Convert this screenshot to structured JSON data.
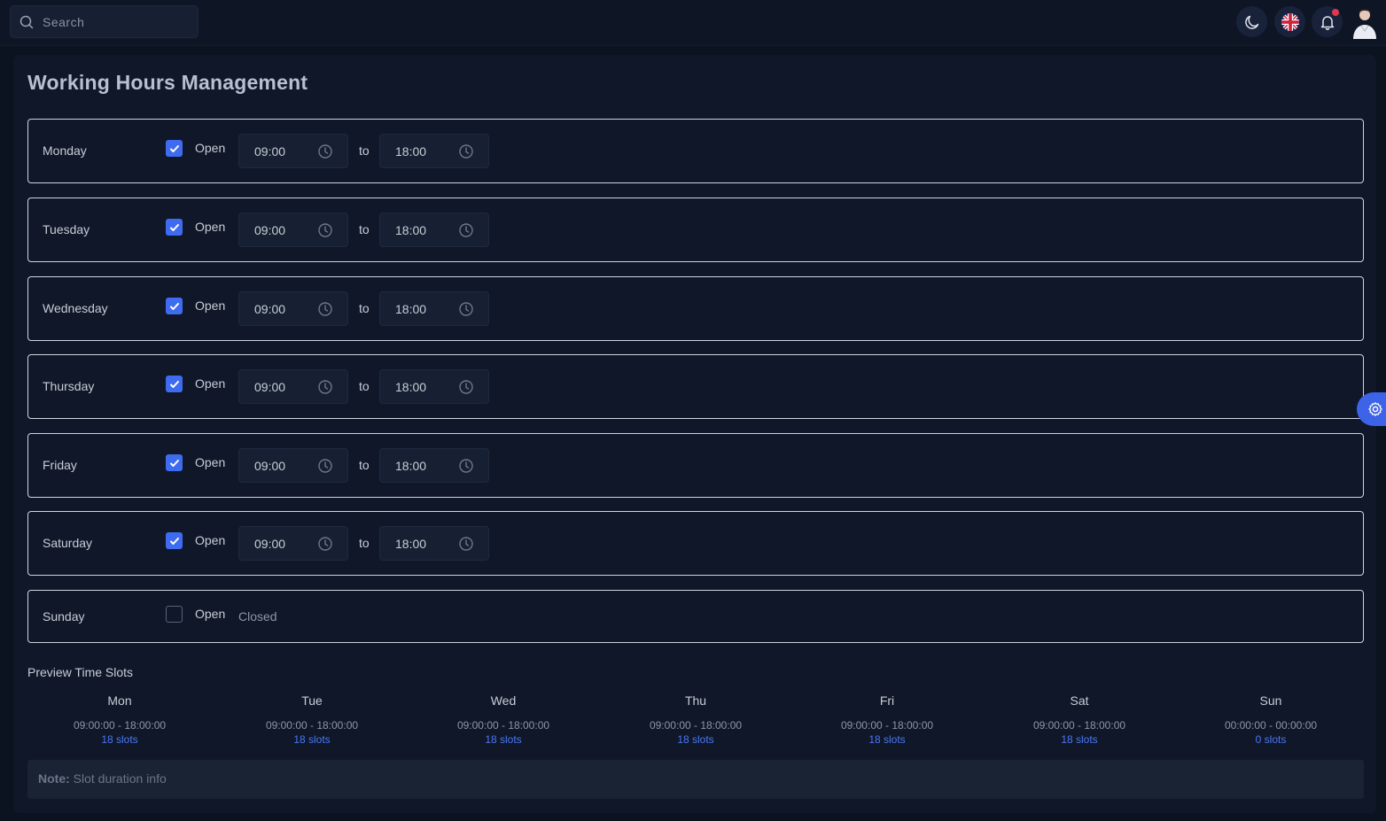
{
  "search": {
    "placeholder": "Search"
  },
  "page_title": "Working Hours Management",
  "open_label": "Open",
  "to_label": "to",
  "days": [
    {
      "name": "Monday",
      "open": true,
      "start": "09:00",
      "end": "18:00"
    },
    {
      "name": "Tuesday",
      "open": true,
      "start": "09:00",
      "end": "18:00"
    },
    {
      "name": "Wednesday",
      "open": true,
      "start": "09:00",
      "end": "18:00"
    },
    {
      "name": "Thursday",
      "open": true,
      "start": "09:00",
      "end": "18:00"
    },
    {
      "name": "Friday",
      "open": true,
      "start": "09:00",
      "end": "18:00"
    },
    {
      "name": "Saturday",
      "open": true,
      "start": "09:00",
      "end": "18:00"
    },
    {
      "name": "Sunday",
      "open": false,
      "status": "Closed"
    }
  ],
  "preview": {
    "title": "Preview Time Slots",
    "columns": [
      {
        "day": "Mon",
        "range": "09:00:00 - 18:00:00",
        "slots": "18 slots"
      },
      {
        "day": "Tue",
        "range": "09:00:00 - 18:00:00",
        "slots": "18 slots"
      },
      {
        "day": "Wed",
        "range": "09:00:00 - 18:00:00",
        "slots": "18 slots"
      },
      {
        "day": "Thu",
        "range": "09:00:00 - 18:00:00",
        "slots": "18 slots"
      },
      {
        "day": "Fri",
        "range": "09:00:00 - 18:00:00",
        "slots": "18 slots"
      },
      {
        "day": "Sat",
        "range": "09:00:00 - 18:00:00",
        "slots": "18 slots"
      },
      {
        "day": "Sun",
        "range": "00:00:00 - 00:00:00",
        "slots": "0 slots"
      }
    ]
  },
  "note": {
    "label": "Note:",
    "text": "Slot duration info"
  },
  "icons": {
    "theme": "moon-icon",
    "language": "uk-flag-icon",
    "notifications": "bell-icon",
    "settings": "gear-icon"
  },
  "colors": {
    "accent": "#3f6bf0",
    "slots_link": "#4a78f5",
    "notification_dot": "#e0384a"
  }
}
